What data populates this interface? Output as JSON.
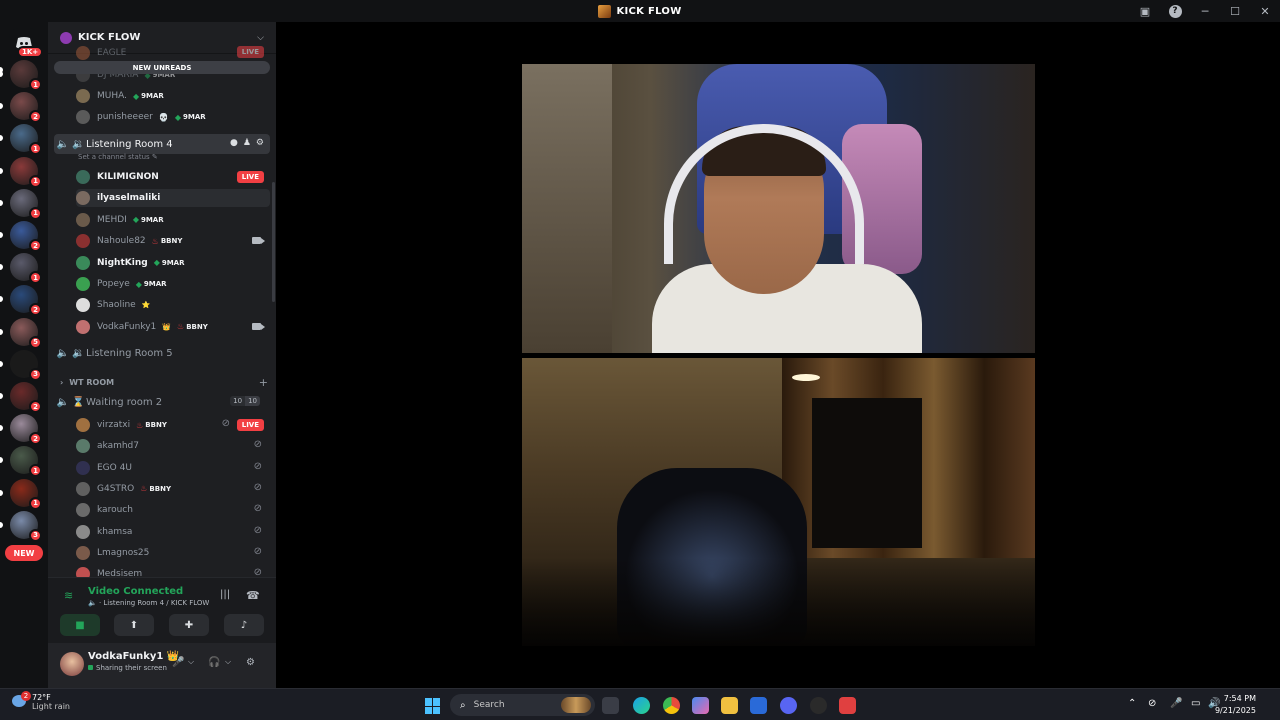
{
  "window": {
    "title": "KICK FLOW"
  },
  "rail": {
    "home_badge": "1K+",
    "servers": [
      {
        "badge": "1"
      },
      {
        "badge": "2"
      },
      {
        "badge": "1"
      },
      {
        "badge": "1"
      },
      {
        "badge": "1"
      },
      {
        "badge": "2"
      },
      {
        "badge": "1"
      },
      {
        "badge": "2"
      },
      {
        "badge": "5"
      },
      {
        "badge": "3"
      },
      {
        "badge": "2"
      },
      {
        "badge": "2"
      },
      {
        "badge": "1"
      },
      {
        "badge": "1"
      },
      {
        "badge": "3"
      }
    ],
    "new_label": "NEW"
  },
  "guild": {
    "name": "KICK FLOW",
    "new_unreads": "NEW UNREADS"
  },
  "partial_rows": [
    {
      "name": "EAGLE",
      "live": "LIVE"
    },
    {
      "name": "DJ MARIA",
      "tag": "9MAR"
    }
  ],
  "members_top": [
    {
      "name": "MUHA.",
      "tag": "9MAR"
    },
    {
      "name": "punisheeeer",
      "icon": "💀",
      "tag": "9MAR"
    }
  ],
  "listening4": {
    "name": "Listening Room 4",
    "status": "Set a channel status",
    "members": [
      {
        "name": "KILIMIGNON",
        "live": "LIVE"
      },
      {
        "name": "ilyaselmaliki"
      },
      {
        "name": "MEHDI",
        "tag": "9MAR"
      },
      {
        "name": "Nahoule82",
        "tag": "BBNY"
      },
      {
        "name": "NightKing",
        "tag": "9MAR"
      },
      {
        "name": "Popeye",
        "tag": "9MAR"
      },
      {
        "name": "Shaoline",
        "icon": "⭐"
      },
      {
        "name": "VodkaFunky1",
        "icon": "👑",
        "tag": "BBNY"
      }
    ]
  },
  "listening5": {
    "name": "Listening Room 5"
  },
  "category": {
    "name": "WT ROOM"
  },
  "waiting2": {
    "name": "Waiting room 2",
    "limit_a": "10",
    "limit_b": "10",
    "members": [
      {
        "name": "virzatxi",
        "tag": "BBNY",
        "live": "LIVE"
      },
      {
        "name": "akamhd7"
      },
      {
        "name": "EGO 4U"
      },
      {
        "name": "G4STRO",
        "tag": "BBNY"
      },
      {
        "name": "karouch"
      },
      {
        "name": "khamsa"
      },
      {
        "name": "Lmagnos25"
      },
      {
        "name": "Medsisem"
      }
    ]
  },
  "voice": {
    "status": "Video Connected",
    "location": "Listening Room 4 / KICK FLOW"
  },
  "user": {
    "name": "VodkaFunky1",
    "crown": "👑",
    "status": "Sharing their screen"
  },
  "taskbar": {
    "temp": "72°F",
    "weather": "Light rain",
    "weather_badge": "2",
    "search": "Search",
    "time": "7:54 PM",
    "date": "9/21/2025"
  },
  "colors": {
    "accent_green": "#23a55a",
    "live_red": "#f23f43",
    "bg_dark": "#1e1f22"
  }
}
